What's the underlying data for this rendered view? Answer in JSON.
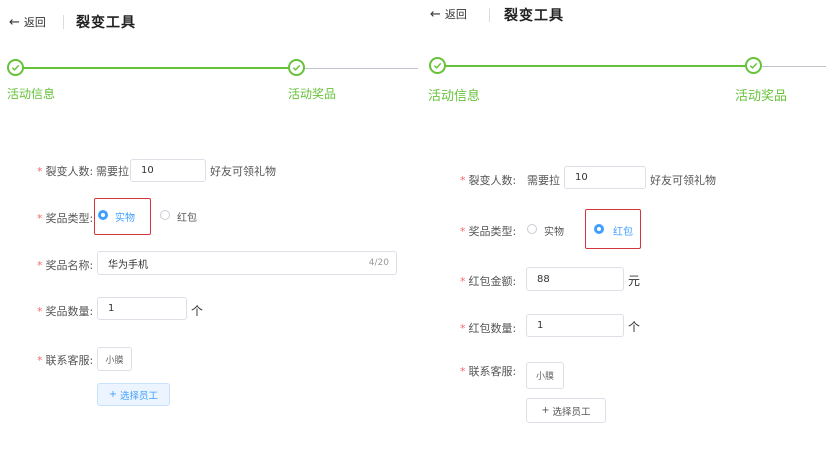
{
  "colors": {
    "accent": "#409eff",
    "success": "#67c23a",
    "required": "#f56c6c",
    "highlight": "#d4363b"
  },
  "left": {
    "back_label": "返回",
    "title": "裂变工具",
    "steps": [
      {
        "label": "活动信息"
      },
      {
        "label": "活动奖品"
      }
    ],
    "form": {
      "fission_count": {
        "label": "裂变人数:",
        "prefix": "需要拉",
        "value": "10",
        "suffix": "好友可领礼物"
      },
      "prize_type": {
        "label": "奖品类型:",
        "options": [
          "实物",
          "红包"
        ],
        "selected": "实物"
      },
      "prize_name": {
        "label": "奖品名称:",
        "value": "华为手机",
        "count": "4/20"
      },
      "prize_quantity": {
        "label": "奖品数量:",
        "value": "1",
        "unit": "个"
      },
      "customer_service": {
        "label": "联系客服:",
        "tag": "小膜",
        "add_button": "选择员工"
      }
    }
  },
  "right": {
    "back_label": "返回",
    "title": "裂变工具",
    "steps": [
      {
        "label": "活动信息"
      },
      {
        "label": "活动奖品"
      }
    ],
    "form": {
      "fission_count": {
        "label": "裂变人数:",
        "prefix": "需要拉",
        "value": "10",
        "suffix": "好友可领礼物"
      },
      "prize_type": {
        "label": "奖品类型:",
        "options": [
          "实物",
          "红包"
        ],
        "selected": "红包"
      },
      "red_packet_amount": {
        "label": "红包金额:",
        "value": "88",
        "unit": "元"
      },
      "red_packet_quantity": {
        "label": "红包数量:",
        "value": "1",
        "unit": "个"
      },
      "customer_service": {
        "label": "联系客服:",
        "tag": "小膜",
        "add_button": "选择员工"
      }
    }
  }
}
